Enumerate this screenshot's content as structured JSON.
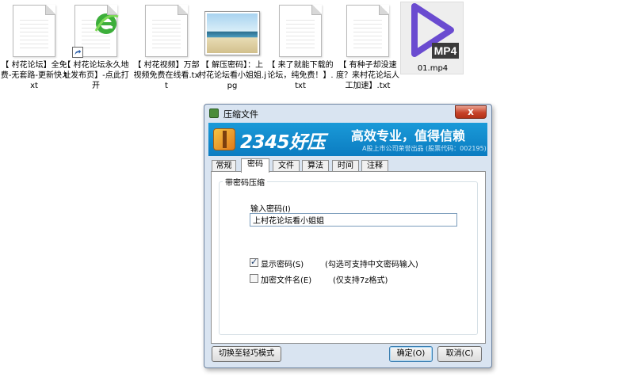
{
  "desktop": {
    "files": [
      {
        "name": "【 村花论坛】全免费-无套路-更新快.txt",
        "type": "text-file-icon"
      },
      {
        "name": "【 村花论坛永久地址发布页】-点此打开",
        "type": "ie-shortcut-icon"
      },
      {
        "name": "【 村花视频】万部视频免费在线看.txt",
        "type": "text-file-icon"
      },
      {
        "name": "【 解压密码】：上村花论坛看小姐姐.jpg",
        "type": "image-file-icon"
      },
      {
        "name": "【 来了就能下载的论坛，纯免费！】.txt",
        "type": "text-file-icon"
      },
      {
        "name": "【 有种子却没速度？来村花论坛人工加速】.txt",
        "type": "text-file-icon"
      },
      {
        "name": "01.mp4",
        "type": "video-file-icon",
        "badge": "MP4"
      }
    ]
  },
  "dialog": {
    "title": "压缩文件",
    "close_label": "x",
    "banner": {
      "brand": "2345好压",
      "slogan": "高效专业，值得信赖",
      "subtitle": "A股上市公司荣誉出品 (股票代码：002195)"
    },
    "tabs": [
      "常规",
      "密码",
      "文件",
      "算法",
      "时间",
      "注释"
    ],
    "active_tab": "密码",
    "group_title": "带密码压缩",
    "password_label": "输入密码(I)",
    "password_value": "上村花论坛看小姐姐",
    "show_password": {
      "label": "显示密码(S)",
      "hint": "(勾选可支持中文密码输入)",
      "checked": true
    },
    "encrypt_names": {
      "label": "加密文件名(E)",
      "hint": "(仅支持7z格式)",
      "checked": false
    },
    "buttons": {
      "switch_mode": "切换至轻巧模式",
      "ok": "确定(O)",
      "cancel": "取消(C)"
    }
  },
  "colors": {
    "banner": "#0b7cc1",
    "dialog_frame": "#d9e4f1",
    "close_button": "#c7432a"
  }
}
